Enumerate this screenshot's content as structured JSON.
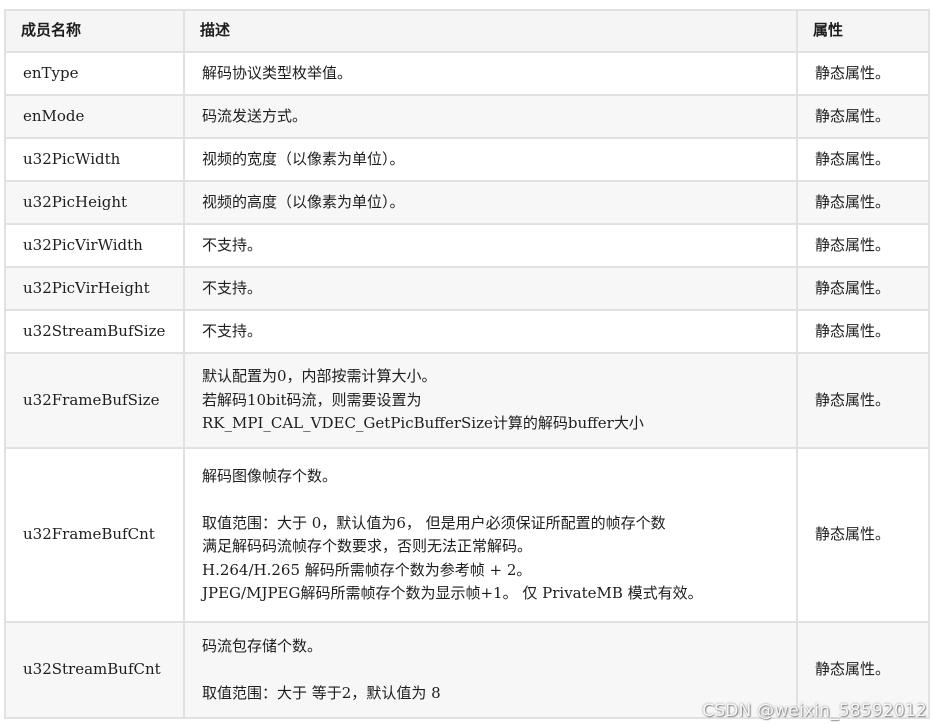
{
  "table": {
    "headers": [
      "成员名称",
      "描述",
      "属性"
    ],
    "rows": [
      {
        "name": "enType",
        "desc": [
          "解码协议类型枚举值。"
        ],
        "attr": "静态属性。"
      },
      {
        "name": "enMode",
        "desc": [
          "码流发送方式。"
        ],
        "attr": "静态属性。"
      },
      {
        "name": "u32PicWidth",
        "desc": [
          "视频的宽度（以像素为单位）。"
        ],
        "attr": "静态属性。"
      },
      {
        "name": "u32PicHeight",
        "desc": [
          "视频的高度（以像素为单位）。"
        ],
        "attr": "静态属性。"
      },
      {
        "name": "u32PicVirWidth",
        "desc": [
          "不支持。"
        ],
        "attr": "静态属性。"
      },
      {
        "name": "u32PicVirHeight",
        "desc": [
          "不支持。"
        ],
        "attr": "静态属性。"
      },
      {
        "name": "u32StreamBufSize",
        "desc": [
          "不支持。"
        ],
        "attr": "静态属性。"
      },
      {
        "name": "u32FrameBufSize",
        "desc": [
          "默认配置为0，内部按需计算大小。",
          "若解码10bit码流，则需要设置为",
          "RK_MPI_CAL_VDEC_GetPicBufferSize计算的解码buffer大小"
        ],
        "attr": "静态属性。"
      },
      {
        "name": "u32FrameBufCnt",
        "desc": [
          "解码图像帧存个数。",
          "",
          "取值范围：大于 0，默认值为6， 但是用户必须保证所配置的帧存个数",
          "满足解码码流帧存个数要求，否则无法正常解码。",
          "H.264/H.265 解码所需帧存个数为参考帧 + 2。",
          "JPEG/MJPEG解码所需帧存个数为显示帧+1。 仅 PrivateMB 模式有效。"
        ],
        "attr": "静态属性。"
      },
      {
        "name": "u32StreamBufCnt",
        "desc": [
          "码流包存储个数。",
          "",
          "取值范围：大于 等于2，默认值为 8"
        ],
        "attr": "静态属性。"
      }
    ]
  },
  "watermark": "CSDN @weixin_58592012"
}
